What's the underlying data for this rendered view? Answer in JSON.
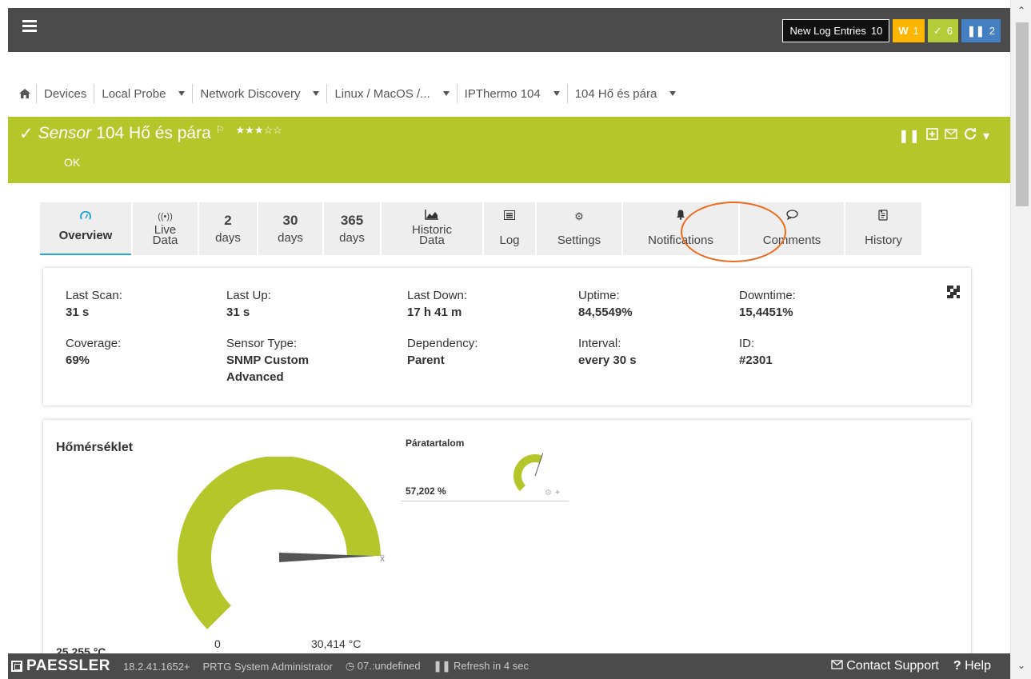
{
  "topbar": {
    "menu_icon": "hamburger-icon",
    "new_log_label": "New Log Entries",
    "new_log_count": "10",
    "warn_label": "W",
    "warn_count": "1",
    "ok_count": "6",
    "paused_count": "2"
  },
  "breadcrumb": {
    "home_icon": "home-icon",
    "items": [
      {
        "label": "Devices",
        "dropdown": false
      },
      {
        "label": "Local Probe",
        "dropdown": true
      },
      {
        "label": "Network Discovery",
        "dropdown": true
      },
      {
        "label": "Linux / MacOS /...",
        "dropdown": true
      },
      {
        "label": "IPThermo 104",
        "dropdown": true
      },
      {
        "label": "104 Hő és pára",
        "dropdown": true
      }
    ]
  },
  "sensor": {
    "type_label": "Sensor",
    "name": "104 Hő és pára",
    "stars": "★★★☆☆",
    "status": "OK",
    "header_color": "#b4c62a"
  },
  "tabs": [
    {
      "icon": "gauge-icon",
      "number": "",
      "label": "Overview",
      "label2": "",
      "active": true
    },
    {
      "icon": "broadcast-icon",
      "number": "",
      "label": "Live",
      "label2": "Data",
      "active": false
    },
    {
      "icon": "",
      "number": "2",
      "label": "days",
      "label2": "",
      "active": false
    },
    {
      "icon": "",
      "number": "30",
      "label": "days",
      "label2": "",
      "active": false
    },
    {
      "icon": "",
      "number": "365",
      "label": "days",
      "label2": "",
      "active": false
    },
    {
      "icon": "area-chart-icon",
      "number": "",
      "label": "Historic",
      "label2": "Data",
      "active": false
    },
    {
      "icon": "list-icon",
      "number": "",
      "label": "Log",
      "label2": "",
      "active": false
    },
    {
      "icon": "gear-icon",
      "number": "",
      "label": "Settings",
      "label2": "",
      "active": false
    },
    {
      "icon": "bell-icon",
      "number": "",
      "label": "Notifications",
      "label2": "",
      "active": false
    },
    {
      "icon": "comment-icon",
      "number": "",
      "label": "Comments",
      "label2": "",
      "active": false
    },
    {
      "icon": "history-icon",
      "number": "",
      "label": "History",
      "label2": "",
      "active": false
    }
  ],
  "info": {
    "last_scan": {
      "label": "Last Scan:",
      "value": "31 s"
    },
    "last_up": {
      "label": "Last Up:",
      "value": "31 s"
    },
    "last_down": {
      "label": "Last Down:",
      "value": "17 h 41 m"
    },
    "uptime": {
      "label": "Uptime:",
      "value": "84,5549%"
    },
    "downtime": {
      "label": "Downtime:",
      "value": "15,4451%"
    },
    "coverage": {
      "label": "Coverage:",
      "value": "69%"
    },
    "sensor_type": {
      "label": "Sensor Type:",
      "value": "SNMP Custom Advanced"
    },
    "dependency": {
      "label": "Dependency:",
      "value": "Parent"
    },
    "interval": {
      "label": "Interval:",
      "value": "every 30 s"
    },
    "id": {
      "label": "ID:",
      "value": "#2301"
    }
  },
  "gauges": {
    "main": {
      "title": "Hőmérséklet",
      "min_label": "0",
      "max_label": "30,414 °C",
      "partial_value": "25,255 °C",
      "fill_fraction": 0.83,
      "mark": "x̄",
      "color": "#b4c62a"
    },
    "small": {
      "title": "Páratartalom",
      "value": "57,202 %",
      "fill_fraction": 0.57
    }
  },
  "bottombar": {
    "brand": "PAESSLER",
    "version": "18.2.41.1652+",
    "user": "PRTG System Administrator",
    "time": "07.:undefined",
    "refresh": "Refresh in 4 sec",
    "contact": "Contact Support",
    "help": "Help"
  }
}
